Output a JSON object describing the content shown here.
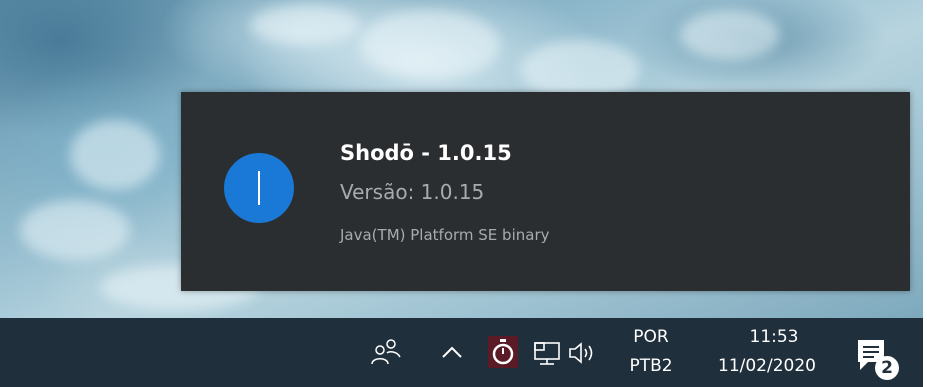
{
  "notification": {
    "title": "Shodō - 1.0.15",
    "line1": "Versão: 1.0.15",
    "line2": "Java(TM) Platform SE binary",
    "icon": "info-icon",
    "accent_color": "#1a78d6"
  },
  "taskbar": {
    "tray_icons": [
      "people-icon",
      "show-hidden-icons-chevron",
      "app-tray-icon",
      "network-icon",
      "volume-icon"
    ],
    "language": {
      "primary": "POR",
      "secondary": "PTB2"
    },
    "clock": {
      "time": "11:53",
      "date": "11/02/2020"
    },
    "notifications": {
      "icon": "action-center-icon",
      "count": "2"
    }
  }
}
